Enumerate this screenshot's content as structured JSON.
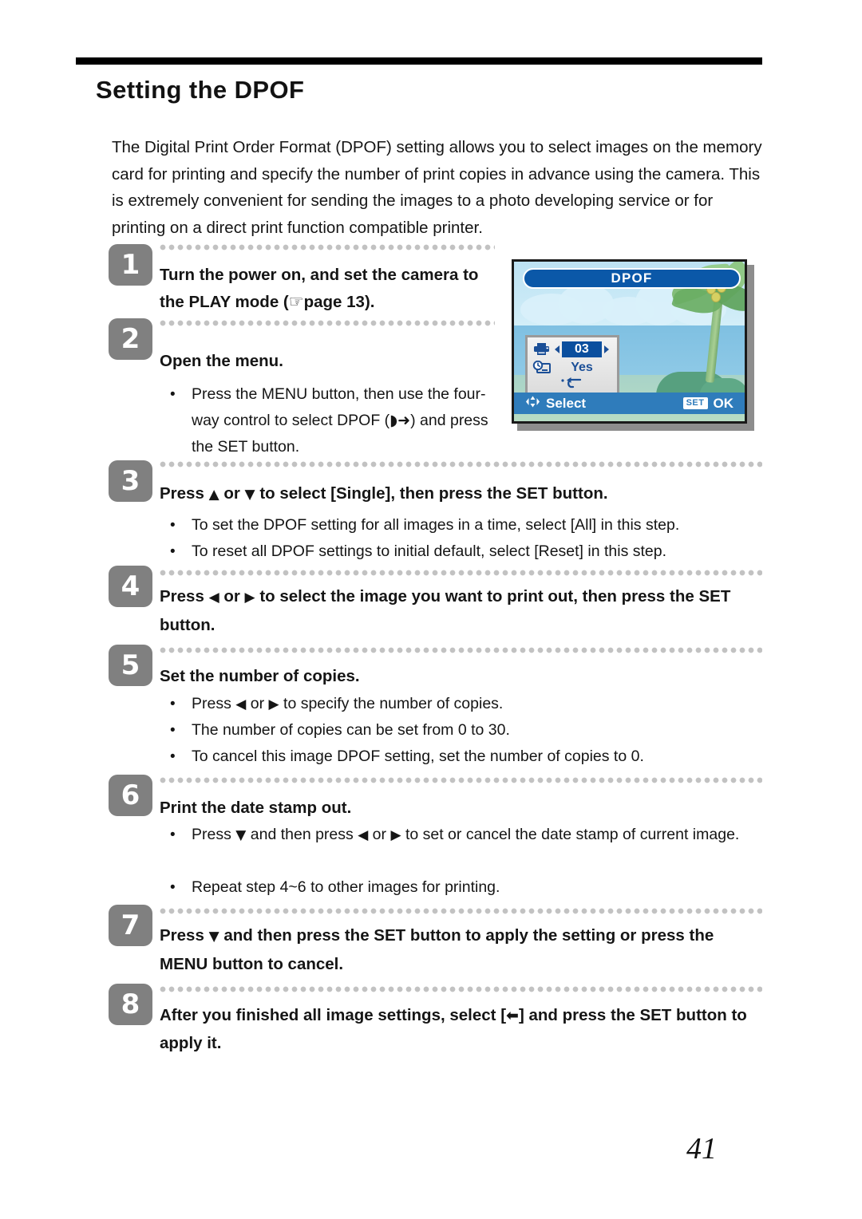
{
  "document": {
    "title": "Setting the DPOF",
    "page_number": "41",
    "intro": "The Digital Print Order Format (DPOF) setting allows you to select images on the memory card for printing and specify the number of print copies in advance using the camera. This is extremely convenient for sending the images to a photo developing service or for printing on a direct print function compatible printer."
  },
  "steps": [
    {
      "number": "1",
      "text_a": "Turn the power on, and set the camera to the PLAY mode (",
      "glyph": "☞",
      "text_b": "page 13)."
    },
    {
      "number": "2",
      "lead": "Open the menu.",
      "bullets": [
        {
          "bullet": "•",
          "text_a": "Press the MENU button, then use the four-way control to select DPOF (",
          "glyph": "◗➜",
          "text_b": ") and press the SET button."
        }
      ]
    },
    {
      "number": "3",
      "lead_a": "Press ",
      "lead_g1": "▲",
      "lead_b": " or ",
      "lead_g2": "▼",
      "lead_c": " to select [Single], then press the SET button.",
      "bullets": [
        {
          "bullet": "•",
          "text": "To set the DPOF setting for all images in a time, select [All] in this step."
        },
        {
          "bullet": "•",
          "text": "To reset all DPOF settings to initial default, select [Reset] in this step."
        }
      ]
    },
    {
      "number": "4",
      "lead_a": "Press ",
      "lead_g1": "◀",
      "lead_b": " or ",
      "lead_g2": "▶",
      "lead_c": " to select the image you want to print out, then press the SET button."
    },
    {
      "number": "5",
      "lead": "Set the number of copies.",
      "bullets": [
        {
          "bullet": "•",
          "text_a": "Press ",
          "g1": "◀",
          "text_b": " or ",
          "g2": "▶",
          "text_c": " to specify the number of copies."
        },
        {
          "bullet": "•",
          "text": "The number of copies can be set from 0 to 30."
        },
        {
          "bullet": "•",
          "text": "To cancel this image DPOF setting, set the number of copies to 0."
        }
      ]
    },
    {
      "number": "6",
      "lead": "Print the date stamp out.",
      "bullets": [
        {
          "bullet": "•",
          "text_a": "Press ",
          "g1": "▼",
          "text_b": " and then press ",
          "g2": "◀",
          "text_c": " or ",
          "g3": "▶",
          "text_d": " to set or cancel the date stamp of current image."
        },
        {
          "bullet": "•",
          "text": "Repeat step 4~6 to other images for printing."
        }
      ]
    },
    {
      "number": "7",
      "lead_a": "Press ",
      "lead_g1": "▼",
      "lead_c": " and then press the SET button to apply the setting or press the MENU button to cancel."
    },
    {
      "number": "8",
      "lead_a": "After you finished all image settings, select [",
      "lead_g1": "⬅",
      "lead_c": "] and press the SET button to apply it."
    }
  ],
  "lcd": {
    "title": "DPOF",
    "panel": {
      "printer_icon": "printer",
      "copies_value": "03",
      "left_arrow": "◀",
      "right_arrow": "▶",
      "date_icon": "date-stamp",
      "date_value": "Yes",
      "return_arrow": "↰"
    },
    "bottom_bar": {
      "nav_icon": "four-way-arrows",
      "nav_label": "Select",
      "set_chip": "SET",
      "set_label": "OK"
    },
    "colors": {
      "title_bar": "#0b58a8",
      "bottom_bar": "#2f7cbb",
      "highlight": "#0b4f9e",
      "text_blue": "#1b4f97",
      "sky": "#c9e9f6",
      "sea": "#8ec9e6",
      "shore": "#b7dcc4"
    }
  }
}
